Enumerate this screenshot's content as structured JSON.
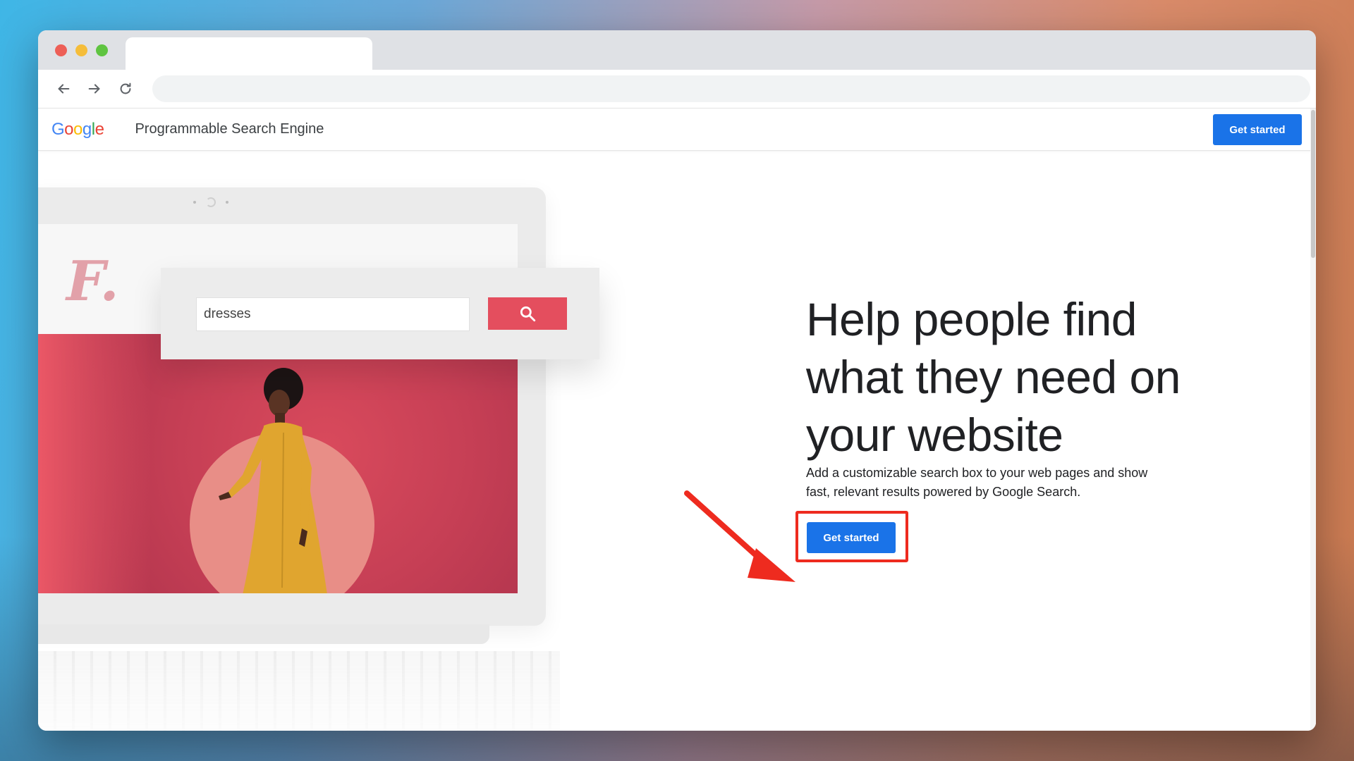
{
  "browser": {
    "tab_title": "",
    "address_bar": ""
  },
  "site": {
    "logo_text": "Google",
    "logo_colors": [
      "#4285F4",
      "#EA4335",
      "#FBBC05",
      "#4285F4",
      "#34A853",
      "#EA4335"
    ],
    "product_name": "Programmable Search Engine",
    "header_cta": "Get started"
  },
  "illustration": {
    "brand_letter": "F.",
    "search_value": "dresses",
    "search_icon": "search-icon"
  },
  "hero": {
    "title": "Help people find what they need on your website",
    "description": "Add a customizable search box to your web pages and show fast, relevant results powered by Google Search.",
    "cta": "Get started"
  },
  "colors": {
    "primary_button": "#1a73e8",
    "search_button": "#e44e5e",
    "annotation": "#ee2b1f"
  }
}
